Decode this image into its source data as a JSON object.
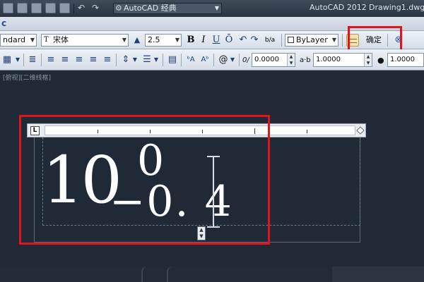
{
  "titlebar": {
    "workspace": "AutoCAD 经典",
    "app_name": "AutoCAD 2012",
    "document": "Drawing1.dwg"
  },
  "ribbon_fragment": "c",
  "format_bar": {
    "style": "ndard",
    "font": "宋体",
    "height": "2.5",
    "bold": "B",
    "italic": "I",
    "underline": "U",
    "overline": "Ō",
    "stack": "b/a",
    "color": "ByLayer",
    "ok_label": "确定"
  },
  "paragraph_bar": {
    "oblique_angle": "0.0000",
    "tracking": "1.0000",
    "width_factor": "1.0000",
    "at_symbol": "@"
  },
  "canvas": {
    "viewport_label": "[俯视][二维线框]",
    "ruler_tab_glyph": "L",
    "main_text": "10",
    "upper_tolerance": "0",
    "lower_tolerance": "−0. 4"
  },
  "icons": {
    "quick_access": [
      "new-icon",
      "open-icon",
      "save-icon",
      "saveas-icon",
      "print-icon",
      "undo-icon",
      "redo-icon"
    ],
    "editor": [
      "ruler-icon",
      "options-icon"
    ]
  },
  "colors": {
    "highlight": "#e0141e",
    "canvas": "#1f2a36",
    "text": "#ffffff"
  }
}
